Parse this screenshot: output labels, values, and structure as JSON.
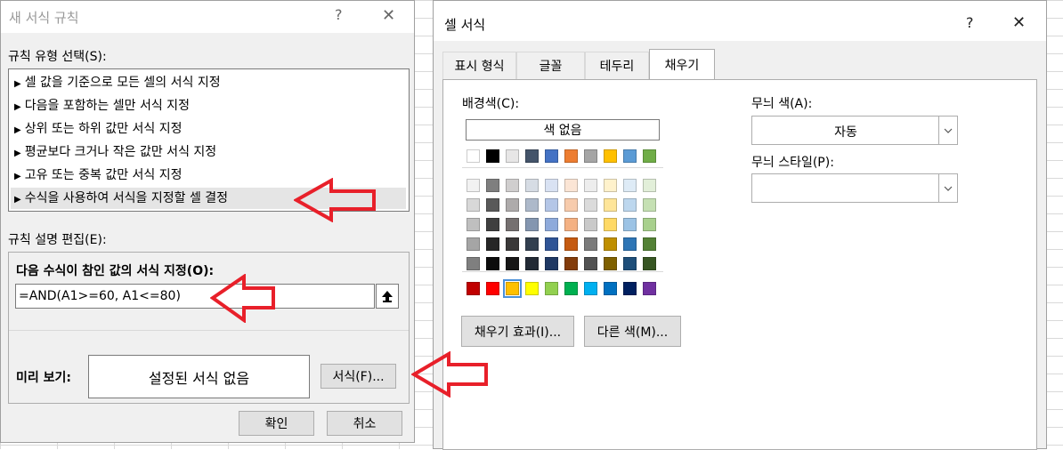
{
  "background": {
    "grid_color": "#d9d9d9"
  },
  "rule_dialog": {
    "title": "새 서식 규칙",
    "help_glyph": "?",
    "close_glyph": "✕",
    "rule_type_label": "규칙 유형 선택(S):",
    "rule_types": [
      "셀 값을 기준으로 모든 셀의 서식 지정",
      "다음을 포함하는 셀만 서식 지정",
      "상위 또는 하위 값만 서식 지정",
      "평균보다 크거나 작은 값만 서식 지정",
      "고유 또는 중복 값만 서식 지정",
      "수식을 사용하여 서식을 지정할 셀 결정"
    ],
    "selected_index": 5,
    "edit_label": "규칙 설명 편집(E):",
    "formula_label": "다음 수식이 참인 값의 서식 지정(O):",
    "formula_value": "=AND(A1>=60, A1<=80)",
    "preview_label": "미리 보기:",
    "preview_text": "설정된 서식 없음",
    "format_button": "서식(F)...",
    "ok_button": "확인",
    "cancel_button": "취소"
  },
  "cell_dialog": {
    "title": "셀 서식",
    "help_glyph": "?",
    "close_glyph": "✕",
    "tabs": [
      "표시 형식",
      "글꼴",
      "테두리",
      "채우기"
    ],
    "active_tab": "채우기",
    "bg_color_label": "배경색(C):",
    "no_color_button": "색 없음",
    "pattern_color_label": "무늬 색(A):",
    "pattern_color_value": "자동",
    "pattern_style_label": "무늬 스타일(P):",
    "pattern_style_value": "",
    "fill_effects_button": "채우기 효과(I)...",
    "more_colors_button": "다른 색(M)...",
    "theme_colors_top": [
      "#ffffff",
      "#000000",
      "#e7e6e6",
      "#44546a",
      "#4472c4",
      "#ed7d31",
      "#a5a5a5",
      "#ffc000",
      "#5b9bd5",
      "#70ad47"
    ],
    "theme_tints": [
      [
        "#f2f2f2",
        "#7f7f7f",
        "#d0cece",
        "#d6dce4",
        "#d9e2f3",
        "#fbe5d5",
        "#ededed",
        "#fff2cc",
        "#deebf6",
        "#e2efd9"
      ],
      [
        "#d8d8d8",
        "#595959",
        "#aeabab",
        "#adb9ca",
        "#b4c6e7",
        "#f7cbac",
        "#dbdbdb",
        "#fee599",
        "#bdd7ee",
        "#c5e0b3"
      ],
      [
        "#bfbfbf",
        "#3f3f3f",
        "#757070",
        "#8496b0",
        "#8eaadb",
        "#f4b183",
        "#c9c9c9",
        "#ffd965",
        "#9cc3e5",
        "#a8d08d"
      ],
      [
        "#a5a5a5",
        "#262626",
        "#3a3838",
        "#323f4f",
        "#2f5496",
        "#c55a11",
        "#7b7b7b",
        "#bf8f00",
        "#2e75b5",
        "#538135"
      ],
      [
        "#7f7f7f",
        "#0c0c0c",
        "#171616",
        "#222a35",
        "#1f3864",
        "#833c0b",
        "#525252",
        "#7f6000",
        "#1e4e79",
        "#375623"
      ]
    ],
    "standard_colors": [
      "#c00000",
      "#ff0000",
      "#ffc000",
      "#ffff00",
      "#92d050",
      "#00b050",
      "#00b0f0",
      "#0070c0",
      "#002060",
      "#7030a0"
    ],
    "selected_standard_color_index": 2
  },
  "annotations": {
    "arrow_color": "#e8202a"
  }
}
